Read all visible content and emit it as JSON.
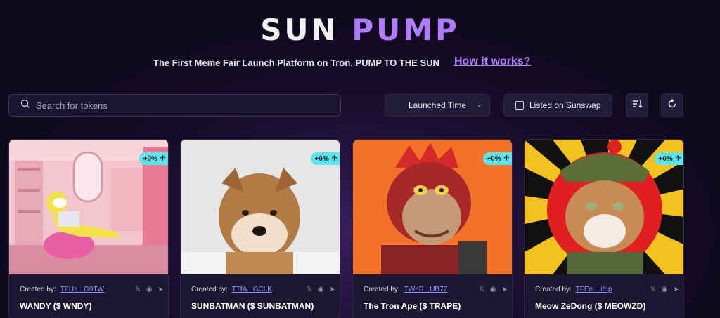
{
  "logo": {
    "part1": "SUN",
    "part2": "PUMP"
  },
  "tagline": "The First Meme Fair Launch Platform on Tron. PUMP TO THE SUN",
  "how_link": "How it works?",
  "search": {
    "placeholder": "Search for tokens",
    "value": ""
  },
  "sort_select": {
    "value": "Launched Time"
  },
  "listed_filter": {
    "label": "Listed on Sunswap",
    "checked": false
  },
  "icons": {
    "sort": "sort-icon",
    "refresh": "refresh-icon"
  },
  "colors": {
    "accent": "#b07cff",
    "badge": "#5ce4e8",
    "link": "#8e95ff"
  },
  "cards": [
    {
      "badge": "+0%",
      "created_label": "Created by:",
      "creator": "TFUa...G9TW",
      "name": "WANDY ($ WNDY)"
    },
    {
      "badge": "+0%",
      "created_label": "Created by:",
      "creator": "TTfA...GCLK",
      "name": "SUNBATMAN ($ SUNBATMAN)"
    },
    {
      "badge": "+0%",
      "created_label": "Created by:",
      "creator": "TWoR...UB77",
      "name": "The Tron Ape ($ TRAPE)"
    },
    {
      "badge": "+0%",
      "created_label": "Created by:",
      "creator": "TFEe....ifhp",
      "name": "Meow ZeDong ($ MEOWZD)"
    }
  ]
}
